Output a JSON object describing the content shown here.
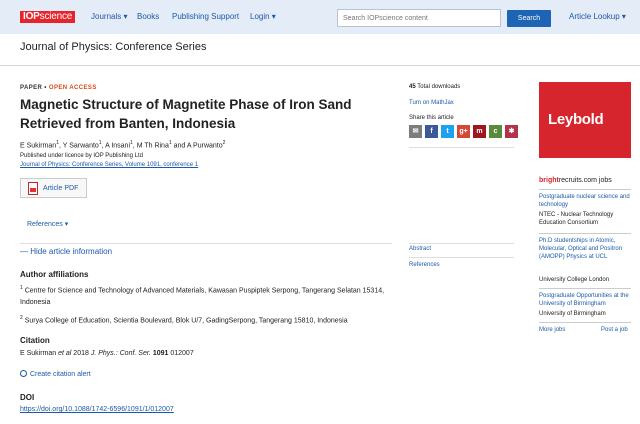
{
  "nav": {
    "logo_a": "IOP",
    "logo_b": "science",
    "journals": "Journals ▾",
    "books": "Books",
    "publishing_support": "Publishing Support",
    "login": "Login ▾",
    "search_placeholder": "Search IOPscience content",
    "search_button": "Search",
    "article_lookup": "Article Lookup ▾"
  },
  "journal_title": "Journal of Physics: Conference Series",
  "article": {
    "type": "PAPER",
    "sep": " • ",
    "access": "OPEN ACCESS",
    "title": "Magnetic Structure of Magnetite Phase of Iron Sand Retrieved from Banten, Indonesia",
    "authors": [
      {
        "name": "E Sukirman",
        "sup": "1"
      },
      {
        "name": "Y Sarwanto",
        "sup": "1"
      },
      {
        "name": "A Insani",
        "sup": "1"
      },
      {
        "name": "M Th Rina",
        "sup": "1"
      },
      {
        "name": "A Purwanto",
        "sup": "2"
      }
    ],
    "author_sep": ", ",
    "author_and": " and ",
    "licence": "Published under licence by IOP Publishing Ltd",
    "journal_link": "Journal of Physics: Conference Series, Volume 1091, conference 1",
    "pdf_button": "Article PDF",
    "references_button": "References ▾",
    "hide_info": "— Hide article information"
  },
  "affiliations": {
    "heading": "Author affiliations",
    "items": [
      {
        "sup": "1",
        "text": "Centre for Science and Technology of Advanced Materials, Kawasan Puspiptek Serpong, Tangerang Selatan 15314, Indonesia"
      },
      {
        "sup": "2",
        "text": "Surya College of Education, Scientia Boulevard, Blok U/7, GadingSerpong, Tangerang 15810, Indonesia"
      }
    ]
  },
  "citation": {
    "heading": "Citation",
    "authors": "E Sukirman ",
    "etal": "et al",
    "year": " 2018 ",
    "journal": "J. Phys.: Conf. Ser.",
    "volume": " 1091",
    "article_no": " 012007",
    "alert": "Create citation alert"
  },
  "doi": {
    "heading": "DOI",
    "link": "https://doi.org/10.1088/1742-6596/1091/1/012007"
  },
  "sidebar": {
    "downloads_count": "45",
    "downloads_label": " Total downloads",
    "mathjax": "Turn on MathJax",
    "share_label": "Share this article",
    "share_icons": [
      {
        "name": "email-share-icon",
        "glyph": "✉",
        "color": "#7d7d7d"
      },
      {
        "name": "facebook-share-icon",
        "glyph": "f",
        "color": "#3b5998"
      },
      {
        "name": "twitter-share-icon",
        "glyph": "t",
        "color": "#1da1f2"
      },
      {
        "name": "googleplus-share-icon",
        "glyph": "g+",
        "color": "#d34836"
      },
      {
        "name": "mendeley-share-icon",
        "glyph": "m",
        "color": "#9d1620"
      },
      {
        "name": "citeulike-share-icon",
        "glyph": "c",
        "color": "#5b8a3c"
      },
      {
        "name": "reddit-share-icon",
        "glyph": "✱",
        "color": "#b2334b"
      }
    ],
    "abstract": "Abstract",
    "references": "References"
  },
  "ads": {
    "leybold": "Leybold",
    "brand_a": "bright",
    "brand_b": "recruits",
    "brand_c": ".com jobs",
    "jobs": [
      {
        "title": "Postgraduate nuclear science and technology",
        "org": "NTEC - Nuclear Technology Education Consortium"
      },
      {
        "title": "Ph.D studentships in Atomic, Molecular, Optical and Positron (AMOPP) Physics at UCL",
        "org": "University College London"
      },
      {
        "title": "Postgraduate Opportunities at the University of Birmingham",
        "org": "University of Birmingham"
      }
    ],
    "more_jobs": "More jobs",
    "post_job": "Post a job"
  }
}
